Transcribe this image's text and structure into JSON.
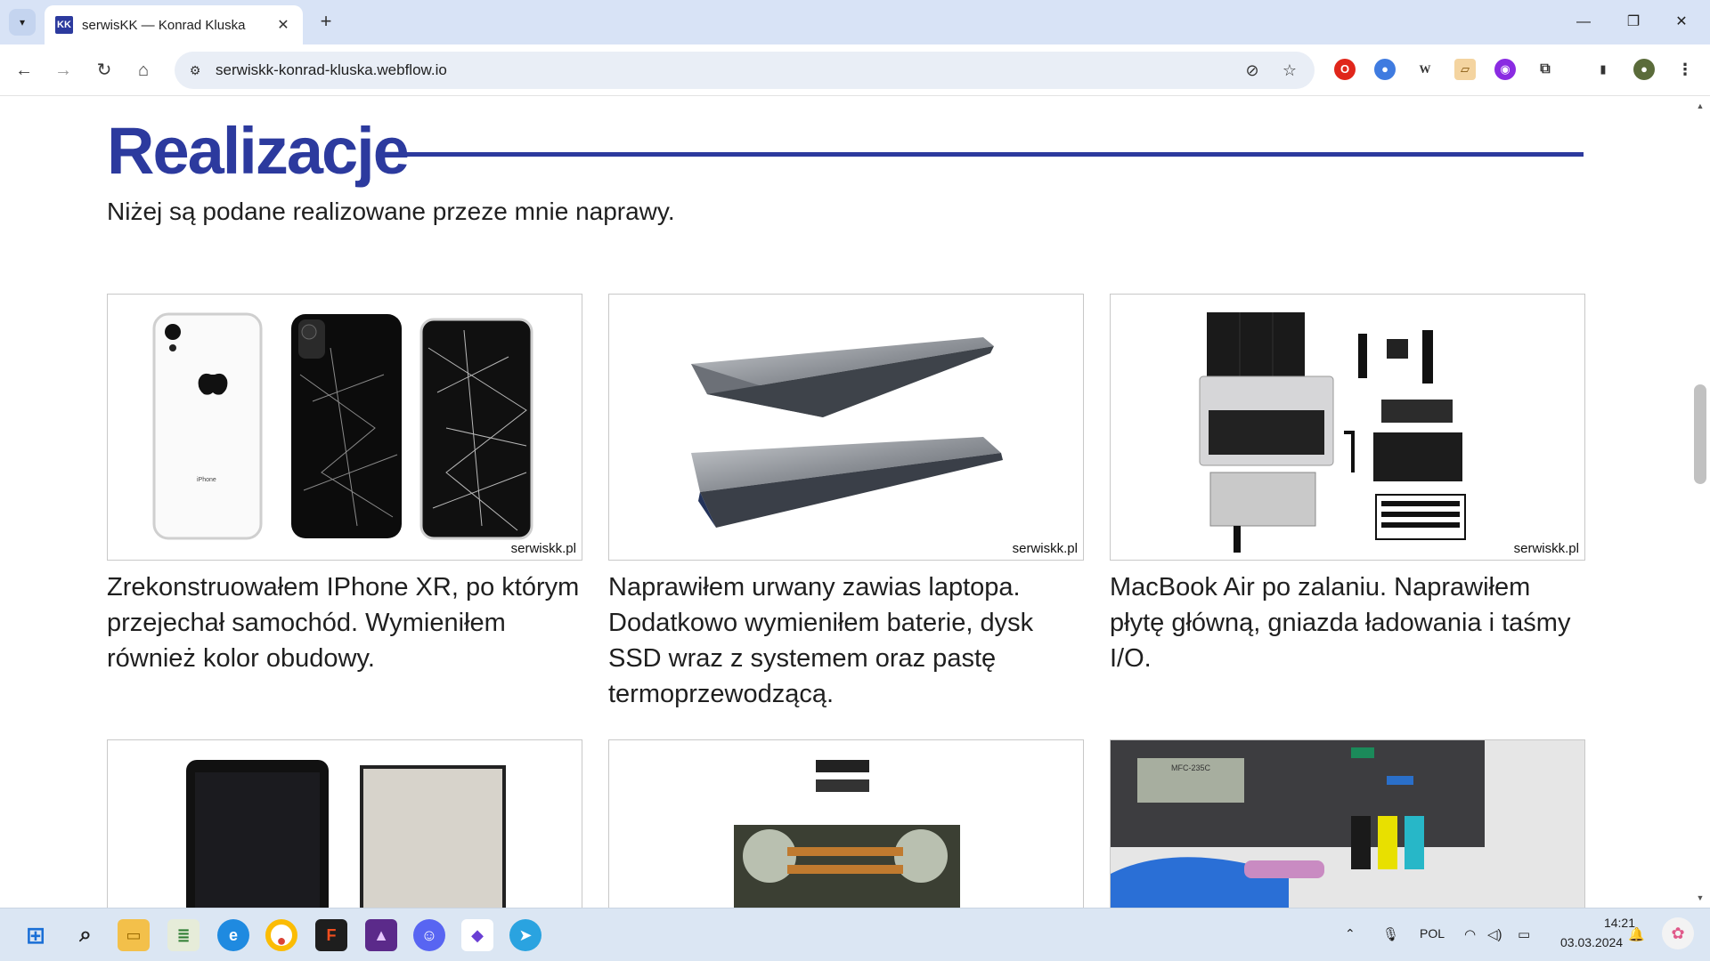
{
  "browser": {
    "tab_title": "serwisKK — Konrad Kluska",
    "favicon_text": "KK",
    "url": "serwiskk-konrad-kluska.webflow.io"
  },
  "page": {
    "heading": "Realizacje",
    "subtitle": "Niżej są podane realizowane przeze mnie naprawy.",
    "accent_color": "#2c3a9e",
    "cards": [
      {
        "watermark": "serwiskk.pl",
        "caption": "Zrekonstruowałem IPhone XR, po którym przejechał samochód. Wymieniłem również kolor obudowy.",
        "image_label": "iPhone"
      },
      {
        "watermark": "serwiskk.pl",
        "caption": "Naprawiłem urwany zawias laptopa. Dodatkowo wymieniłem baterie, dysk SSD wraz z systemem oraz pastę termoprzewodzącą."
      },
      {
        "watermark": "serwiskk.pl",
        "caption": "MacBook Air po zalaniu. Naprawiłem płytę główną, gniazda ładowania i taśmy I/O."
      }
    ],
    "printer_label": "MFC-235C"
  },
  "taskbar": {
    "language": "POL",
    "time": "14:21",
    "date": "03.03.2024"
  }
}
